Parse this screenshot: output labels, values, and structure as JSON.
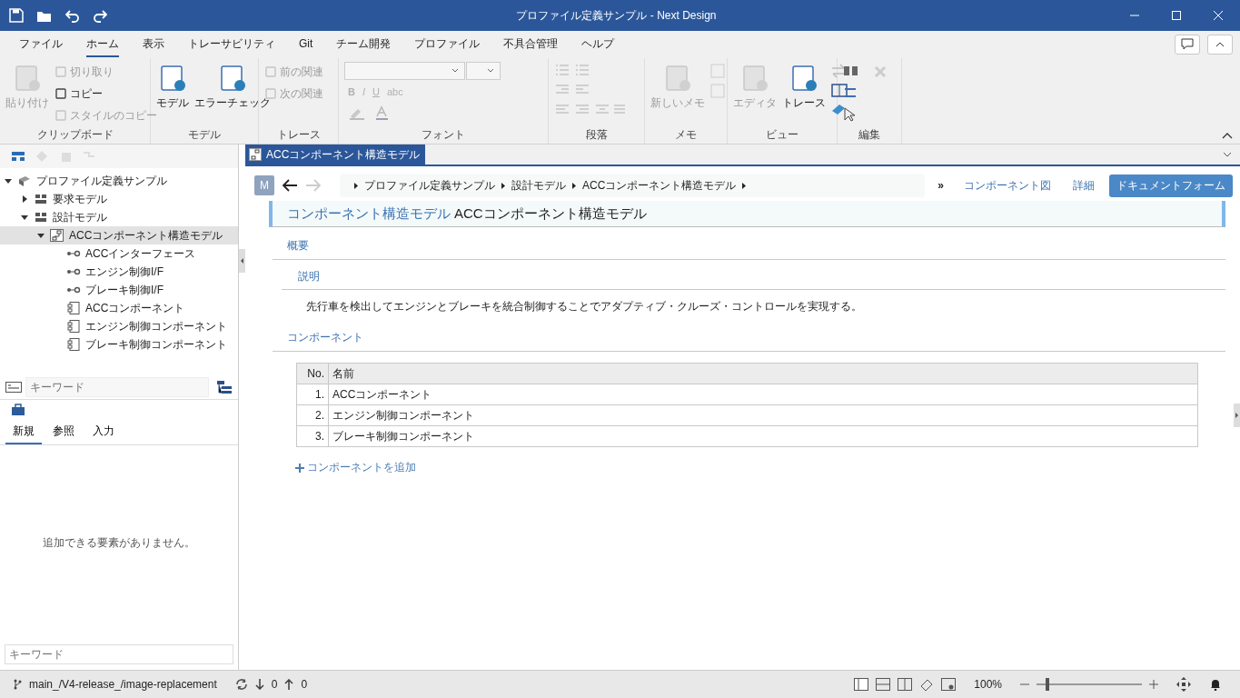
{
  "window": {
    "title": "プロファイル定義サンプル - Next Design"
  },
  "menu_tabs": [
    {
      "label": "ファイル",
      "selected": false
    },
    {
      "label": "ホーム",
      "selected": true
    },
    {
      "label": "表示",
      "selected": false
    },
    {
      "label": "トレーサビリティ",
      "selected": false
    },
    {
      "label": "Git",
      "selected": false
    },
    {
      "label": "チーム開発",
      "selected": false
    },
    {
      "label": "プロファイル",
      "selected": false
    },
    {
      "label": "不具合管理",
      "selected": false
    },
    {
      "label": "ヘルプ",
      "selected": false
    }
  ],
  "ribbon": [
    {
      "label": "クリップボード",
      "buttons": [
        {
          "label": "貼り付け",
          "kind": "large",
          "disabled": true
        },
        {
          "label": "切り取り",
          "kind": "small",
          "disabled": true
        },
        {
          "label": "コピー",
          "kind": "small",
          "disabled": false
        },
        {
          "label": "スタイルのコピー",
          "kind": "small",
          "disabled": true
        }
      ]
    },
    {
      "label": "モデル",
      "buttons": [
        {
          "label": "モデル",
          "kind": "large",
          "disabled": false
        },
        {
          "label": "エラーチェック",
          "kind": "large",
          "disabled": false
        }
      ]
    },
    {
      "label": "トレース",
      "buttons": [
        {
          "label": "前の関連",
          "kind": "small",
          "disabled": true
        },
        {
          "label": "次の関連",
          "kind": "small",
          "disabled": true
        }
      ]
    },
    {
      "label": "フォント",
      "buttons": [
        {
          "label": "B",
          "kind": "glyph",
          "disabled": true
        },
        {
          "label": "I",
          "kind": "glyph",
          "disabled": true
        },
        {
          "label": "U",
          "kind": "glyph",
          "disabled": true
        },
        {
          "label": "abc",
          "kind": "glyph",
          "disabled": true
        }
      ]
    },
    {
      "label": "段落"
    },
    {
      "label": "メモ",
      "buttons": [
        {
          "label": "新しいメモ",
          "kind": "large",
          "disabled": true
        }
      ]
    },
    {
      "label": "ビュー",
      "buttons": [
        {
          "label": "エディタ",
          "kind": "large",
          "disabled": true
        },
        {
          "label": "トレース",
          "kind": "large",
          "disabled": false
        }
      ]
    },
    {
      "label": "編集"
    }
  ],
  "model_tree": [
    {
      "label": "プロファイル定義サンプル",
      "kind": "project",
      "expanded": true,
      "selected": false,
      "children": [
        {
          "label": "要求モデル",
          "kind": "package",
          "expanded": false,
          "selected": false
        },
        {
          "label": "設計モデル",
          "kind": "package",
          "expanded": true,
          "selected": false,
          "children": [
            {
              "label": "ACCコンポーネント構造モデル",
              "kind": "model",
              "expanded": true,
              "selected": true,
              "children": [
                {
                  "label": "ACCインターフェース",
                  "kind": "interface",
                  "selected": false
                },
                {
                  "label": "エンジン制御I/F",
                  "kind": "interface",
                  "selected": false
                },
                {
                  "label": "ブレーキ制御I/F",
                  "kind": "interface",
                  "selected": false
                },
                {
                  "label": "ACCコンポーネント",
                  "kind": "component",
                  "selected": false
                },
                {
                  "label": "エンジン制御コンポーネント",
                  "kind": "component",
                  "selected": false
                },
                {
                  "label": "ブレーキ制御コンポーネント",
                  "kind": "component",
                  "selected": false
                }
              ]
            }
          ]
        }
      ]
    }
  ],
  "tree_search": {
    "placeholder": "キーワード"
  },
  "panel_tabs": [
    {
      "label": "新規",
      "selected": true
    },
    {
      "label": "参照",
      "selected": false
    },
    {
      "label": "入力",
      "selected": false
    }
  ],
  "panel_message": "追加できる要素がありません。",
  "panel_search": {
    "placeholder": "キーワード"
  },
  "editor": {
    "tab": "ACCコンポーネント構造モデル",
    "avatar": "M",
    "breadcrumb": [
      "プロファイル定義サンプル",
      "設計モデル",
      "ACCコンポーネント構造モデル"
    ],
    "more": "»",
    "views": [
      {
        "label": "コンポーネント図",
        "selected": false
      },
      {
        "label": "詳細",
        "selected": false
      },
      {
        "label": "ドキュメントフォーム",
        "selected": true
      }
    ],
    "heading_type": "コンポーネント構造モデル",
    "heading_name": "ACCコンポーネント構造モデル",
    "overview": {
      "title": "概要",
      "field_label": "説明",
      "field_value": "先行車を検出してエンジンとブレーキを統合制御することでアダプティブ・クルーズ・コントロールを実現する。"
    },
    "components": {
      "title": "コンポーネント",
      "columns": [
        "No.",
        "名前"
      ],
      "rows": [
        [
          "1.",
          "ACCコンポーネント"
        ],
        [
          "2.",
          "エンジン制御コンポーネント"
        ],
        [
          "3.",
          "ブレーキ制御コンポーネント"
        ]
      ],
      "add_link": "コンポーネントを追加"
    }
  },
  "status_bar": {
    "branch": "main_/V4-release_/image-replacement",
    "incoming": "0",
    "outgoing": "0",
    "zoom": "100%",
    "zoom_slider": {
      "level": 0.1
    }
  }
}
